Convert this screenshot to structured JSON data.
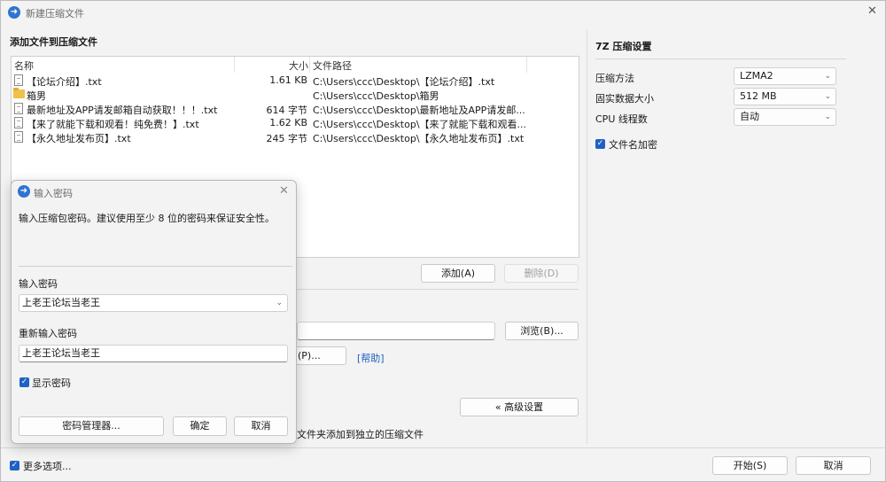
{
  "window": {
    "title": "新建压缩文件"
  },
  "main": {
    "heading": "添加文件到压缩文件",
    "columns": [
      "名称",
      "大小",
      "文件路径"
    ],
    "files": [
      {
        "icon": "file",
        "name": "【论坛介绍】.txt",
        "size": "1.61 KB",
        "path": "C:\\Users\\ccc\\Desktop\\【论坛介绍】.txt"
      },
      {
        "icon": "folder",
        "name": "箱男",
        "size": "",
        "path": "C:\\Users\\ccc\\Desktop\\箱男"
      },
      {
        "icon": "file",
        "name": "最新地址及APP请发邮箱自动获取！！！.txt",
        "size": "614 字节",
        "path": "C:\\Users\\ccc\\Desktop\\最新地址及APP请发邮..."
      },
      {
        "icon": "file",
        "name": "【来了就能下载和观看！纯免费！】.txt",
        "size": "1.62 KB",
        "path": "C:\\Users\\ccc\\Desktop\\【来了就能下载和观看..."
      },
      {
        "icon": "file",
        "name": "【永久地址发布页】.txt",
        "size": "245 字节",
        "path": "C:\\Users\\ccc\\Desktop\\【永久地址发布页】.txt"
      }
    ],
    "add_button": "添加(A)",
    "delete_button": "删除(D)",
    "browse_button": "浏览(B)...",
    "partial_password_button": "(P)...",
    "help_link": "[帮助]",
    "advanced_button": "« 高级设置",
    "partial_separate_text": "文件夹添加到独立的压缩文件",
    "more_options_label": "更多选项...",
    "start_button": "开始(S)",
    "cancel_button": "取消"
  },
  "settings": {
    "heading": "7Z 压缩设置",
    "method_label": "压缩方法",
    "method_value": "LZMA2",
    "dict_label": "固实数据大小",
    "dict_value": "512 MB",
    "threads_label": "CPU 线程数",
    "threads_value": "自动",
    "encrypt_names_label": "文件名加密"
  },
  "dialog": {
    "title": "输入密码",
    "description": "输入压缩包密码。建议使用至少 8 位的密码来保证安全性。",
    "password_label": "输入密码",
    "password_value": "上老王论坛当老王",
    "confirm_label": "重新输入密码",
    "confirm_value": "上老王论坛当老王",
    "show_password_label": "显示密码",
    "manager_button": "密码管理器...",
    "ok_button": "确定",
    "cancel_button": "取消"
  }
}
